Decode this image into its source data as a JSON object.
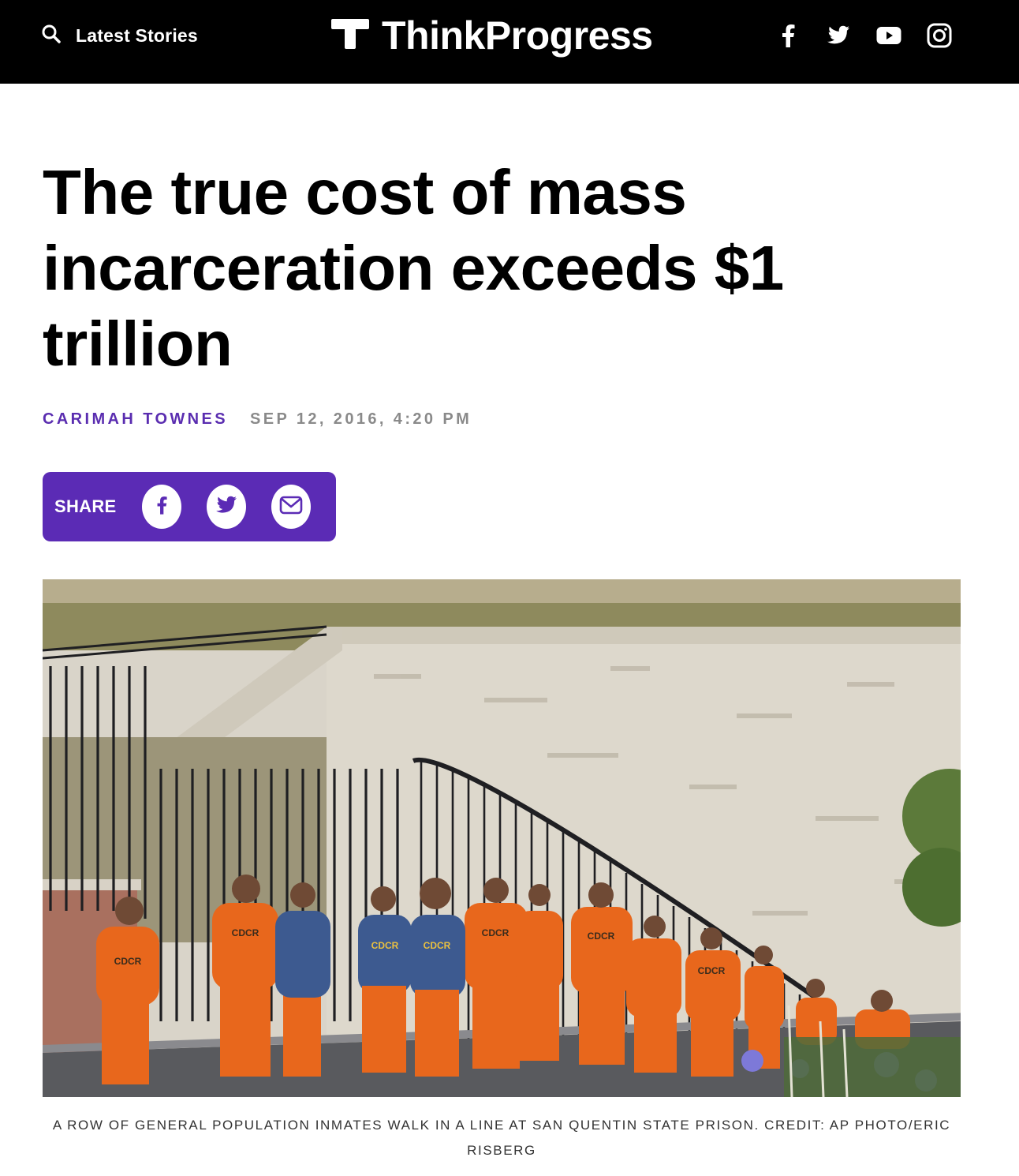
{
  "topbar": {
    "latest_label": "Latest Stories",
    "brand_name": "ThinkProgress",
    "social": [
      "facebook-icon",
      "twitter-icon",
      "youtube-icon",
      "instagram-icon"
    ]
  },
  "article": {
    "headline": "The true cost of mass incarceration exceeds $1 trillion",
    "author": "CARIMAH TOWNES",
    "date": "SEP 12, 2016, 4:20 PM"
  },
  "share": {
    "label": "SHARE",
    "buttons": [
      "facebook-icon",
      "twitter-icon",
      "mail-icon"
    ],
    "bg_color": "#5b2bb5"
  },
  "photo": {
    "badge_text": "CDCR",
    "caption": "A row of general population inmates walk in a line at San Quentin State Prison. Credit: AP Photo/Eric Risberg"
  },
  "colors": {
    "accent": "#5b2bb5",
    "author": "#5a2db0",
    "topbar": "#000000"
  }
}
